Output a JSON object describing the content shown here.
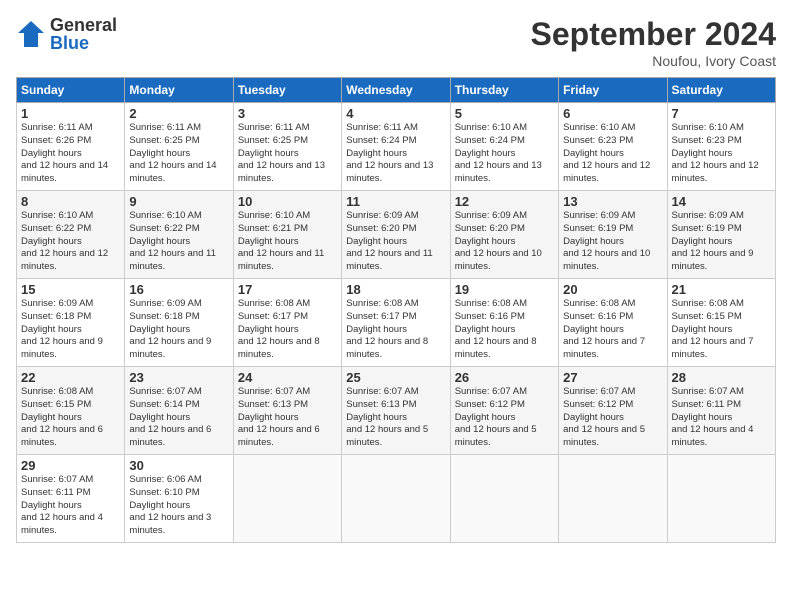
{
  "logo": {
    "general": "General",
    "blue": "Blue"
  },
  "title": {
    "month": "September 2024",
    "location": "Noufou, Ivory Coast"
  },
  "headers": [
    "Sunday",
    "Monday",
    "Tuesday",
    "Wednesday",
    "Thursday",
    "Friday",
    "Saturday"
  ],
  "weeks": [
    [
      {
        "day": "1",
        "sunrise": "6:11 AM",
        "sunset": "6:26 PM",
        "daylight": "12 hours and 14 minutes."
      },
      {
        "day": "2",
        "sunrise": "6:11 AM",
        "sunset": "6:25 PM",
        "daylight": "12 hours and 14 minutes."
      },
      {
        "day": "3",
        "sunrise": "6:11 AM",
        "sunset": "6:25 PM",
        "daylight": "12 hours and 13 minutes."
      },
      {
        "day": "4",
        "sunrise": "6:11 AM",
        "sunset": "6:24 PM",
        "daylight": "12 hours and 13 minutes."
      },
      {
        "day": "5",
        "sunrise": "6:10 AM",
        "sunset": "6:24 PM",
        "daylight": "12 hours and 13 minutes."
      },
      {
        "day": "6",
        "sunrise": "6:10 AM",
        "sunset": "6:23 PM",
        "daylight": "12 hours and 12 minutes."
      },
      {
        "day": "7",
        "sunrise": "6:10 AM",
        "sunset": "6:23 PM",
        "daylight": "12 hours and 12 minutes."
      }
    ],
    [
      {
        "day": "8",
        "sunrise": "6:10 AM",
        "sunset": "6:22 PM",
        "daylight": "12 hours and 12 minutes."
      },
      {
        "day": "9",
        "sunrise": "6:10 AM",
        "sunset": "6:22 PM",
        "daylight": "12 hours and 11 minutes."
      },
      {
        "day": "10",
        "sunrise": "6:10 AM",
        "sunset": "6:21 PM",
        "daylight": "12 hours and 11 minutes."
      },
      {
        "day": "11",
        "sunrise": "6:09 AM",
        "sunset": "6:20 PM",
        "daylight": "12 hours and 11 minutes."
      },
      {
        "day": "12",
        "sunrise": "6:09 AM",
        "sunset": "6:20 PM",
        "daylight": "12 hours and 10 minutes."
      },
      {
        "day": "13",
        "sunrise": "6:09 AM",
        "sunset": "6:19 PM",
        "daylight": "12 hours and 10 minutes."
      },
      {
        "day": "14",
        "sunrise": "6:09 AM",
        "sunset": "6:19 PM",
        "daylight": "12 hours and 9 minutes."
      }
    ],
    [
      {
        "day": "15",
        "sunrise": "6:09 AM",
        "sunset": "6:18 PM",
        "daylight": "12 hours and 9 minutes."
      },
      {
        "day": "16",
        "sunrise": "6:09 AM",
        "sunset": "6:18 PM",
        "daylight": "12 hours and 9 minutes."
      },
      {
        "day": "17",
        "sunrise": "6:08 AM",
        "sunset": "6:17 PM",
        "daylight": "12 hours and 8 minutes."
      },
      {
        "day": "18",
        "sunrise": "6:08 AM",
        "sunset": "6:17 PM",
        "daylight": "12 hours and 8 minutes."
      },
      {
        "day": "19",
        "sunrise": "6:08 AM",
        "sunset": "6:16 PM",
        "daylight": "12 hours and 8 minutes."
      },
      {
        "day": "20",
        "sunrise": "6:08 AM",
        "sunset": "6:16 PM",
        "daylight": "12 hours and 7 minutes."
      },
      {
        "day": "21",
        "sunrise": "6:08 AM",
        "sunset": "6:15 PM",
        "daylight": "12 hours and 7 minutes."
      }
    ],
    [
      {
        "day": "22",
        "sunrise": "6:08 AM",
        "sunset": "6:15 PM",
        "daylight": "12 hours and 6 minutes."
      },
      {
        "day": "23",
        "sunrise": "6:07 AM",
        "sunset": "6:14 PM",
        "daylight": "12 hours and 6 minutes."
      },
      {
        "day": "24",
        "sunrise": "6:07 AM",
        "sunset": "6:13 PM",
        "daylight": "12 hours and 6 minutes."
      },
      {
        "day": "25",
        "sunrise": "6:07 AM",
        "sunset": "6:13 PM",
        "daylight": "12 hours and 5 minutes."
      },
      {
        "day": "26",
        "sunrise": "6:07 AM",
        "sunset": "6:12 PM",
        "daylight": "12 hours and 5 minutes."
      },
      {
        "day": "27",
        "sunrise": "6:07 AM",
        "sunset": "6:12 PM",
        "daylight": "12 hours and 5 minutes."
      },
      {
        "day": "28",
        "sunrise": "6:07 AM",
        "sunset": "6:11 PM",
        "daylight": "12 hours and 4 minutes."
      }
    ],
    [
      {
        "day": "29",
        "sunrise": "6:07 AM",
        "sunset": "6:11 PM",
        "daylight": "12 hours and 4 minutes."
      },
      {
        "day": "30",
        "sunrise": "6:06 AM",
        "sunset": "6:10 PM",
        "daylight": "12 hours and 3 minutes."
      },
      null,
      null,
      null,
      null,
      null
    ]
  ]
}
